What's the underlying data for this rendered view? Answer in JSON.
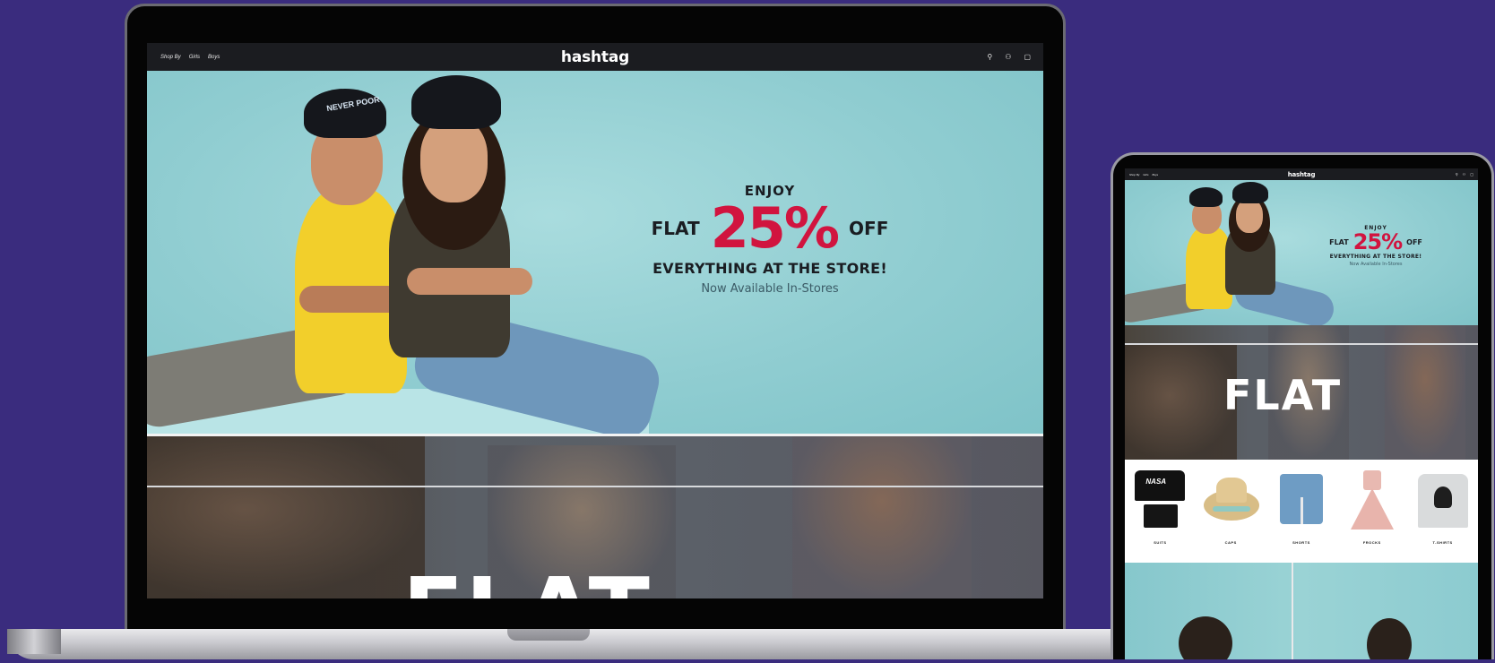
{
  "site": {
    "logo": "hashtag",
    "nav": [
      "Shop By",
      "Girls",
      "Boys"
    ],
    "icons": [
      "search-icon",
      "user-icon",
      "bag-icon"
    ]
  },
  "hero": {
    "enjoy": "ENJOY",
    "flat": "FLAT",
    "percent": "25%",
    "off": "OFF",
    "everything": "EVERYTHING AT THE STORE!",
    "available": "Now Available In-Stores",
    "cap_text": "NEVER POOR"
  },
  "banner": {
    "flat": "FLAT"
  },
  "categories": [
    {
      "label": "SUITS",
      "print": "NASA"
    },
    {
      "label": "CAPS"
    },
    {
      "label": "SHORTS"
    },
    {
      "label": "FROCKS"
    },
    {
      "label": "T-SHIRTS"
    }
  ],
  "colors": {
    "background": "#3a2c7e",
    "accent": "#d1143f",
    "topbar": "#1b1c20",
    "hero": "#90cdd1"
  }
}
